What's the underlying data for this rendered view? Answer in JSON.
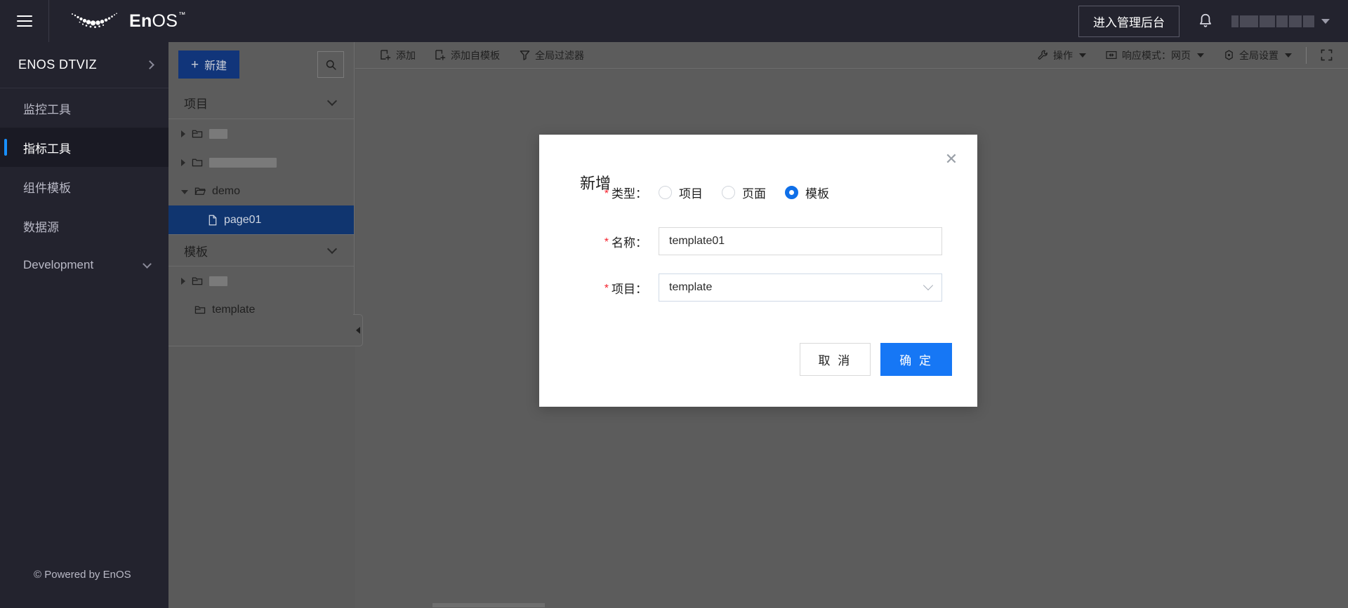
{
  "topbar": {
    "menu_icon": "hamburger-icon",
    "brand_en": "En",
    "brand_os": "OS",
    "brand_tm": "™",
    "admin_button": "进入管理后台",
    "bell_icon": "bell-icon",
    "user_name_redacted": "",
    "caret_icon": "chevron-down-icon"
  },
  "leftnav": {
    "title": "ENOS DTVIZ",
    "expand_icon": "chevron-right-icon",
    "items": [
      {
        "label": "监控工具",
        "active": false,
        "has_chevron": false
      },
      {
        "label": "指标工具",
        "active": true,
        "has_chevron": false
      },
      {
        "label": "组件模板",
        "active": false,
        "has_chevron": false
      },
      {
        "label": "数据源",
        "active": false,
        "has_chevron": false
      },
      {
        "label": "Development",
        "active": false,
        "has_chevron": true
      }
    ],
    "footer": "© Powered by EnOS"
  },
  "tree": {
    "new_button": "新建",
    "new_button_icon": "plus-icon",
    "search_icon": "search-icon",
    "groups": [
      {
        "title": "项目",
        "chevron_icon": "chevron-down-icon",
        "rows": [
          {
            "label": "",
            "redacted": true,
            "redact_w": 26,
            "icon": "folder-icon",
            "arrow": "closed",
            "indent": false,
            "selected": false
          },
          {
            "label": "",
            "redacted": true,
            "redact_w": 96,
            "icon": "folder-icon",
            "arrow": "closed",
            "indent": false,
            "selected": false
          },
          {
            "label": "demo",
            "redacted": false,
            "icon": "folder-open-icon",
            "arrow": "open",
            "indent": false,
            "selected": false
          },
          {
            "label": "page01",
            "redacted": false,
            "icon": "file-icon",
            "arrow": "none",
            "indent": true,
            "selected": true
          }
        ]
      },
      {
        "title": "模板",
        "chevron_icon": "chevron-down-icon",
        "rows": [
          {
            "label": "",
            "redacted": true,
            "redact_w": 26,
            "icon": "folder-icon",
            "arrow": "closed",
            "indent": false,
            "selected": false
          },
          {
            "label": "template",
            "redacted": false,
            "icon": "folder-icon",
            "arrow": "none",
            "indent": false,
            "selected": false
          }
        ]
      }
    ],
    "collapse_icon": "collapse-left-icon"
  },
  "toolbar": {
    "left": [
      {
        "label": "添加",
        "icon": "add-block-icon"
      },
      {
        "label": "添加自模板",
        "icon": "add-from-template-icon"
      },
      {
        "label": "全局过滤器",
        "icon": "filter-icon"
      }
    ],
    "right": [
      {
        "label": "操作",
        "icon": "wrench-icon",
        "caret": true
      },
      {
        "label": "响应模式：网页",
        "icon": "responsive-icon",
        "caret": true
      },
      {
        "label": "全局设置",
        "icon": "gear-icon",
        "caret": true
      }
    ],
    "fullscreen_icon": "fullscreen-icon"
  },
  "modal": {
    "title": "新增",
    "close_icon": "close-icon",
    "fields": {
      "type": {
        "label": "类型：",
        "required": true,
        "options": [
          {
            "label": "项目",
            "checked": false
          },
          {
            "label": "页面",
            "checked": false
          },
          {
            "label": "模板",
            "checked": true
          }
        ]
      },
      "name": {
        "label": "名称：",
        "required": true,
        "value": "template01",
        "placeholder": ""
      },
      "project": {
        "label": "项目：",
        "required": true,
        "value": "template",
        "caret_icon": "chevron-down-icon"
      }
    },
    "cancel_button": "取 消",
    "confirm_button": "确 定"
  },
  "colors": {
    "header_bg": "#23232e",
    "nav_bg": "#23232e",
    "nav_active_bg": "#1a1a24",
    "accent": "#1890ff",
    "canvas_bg": "#5c5c5c",
    "tree_selected": "#10356f",
    "primary_button": "#1677f5",
    "required_star": "#f5222d",
    "new_button_bg": "#11357a"
  }
}
